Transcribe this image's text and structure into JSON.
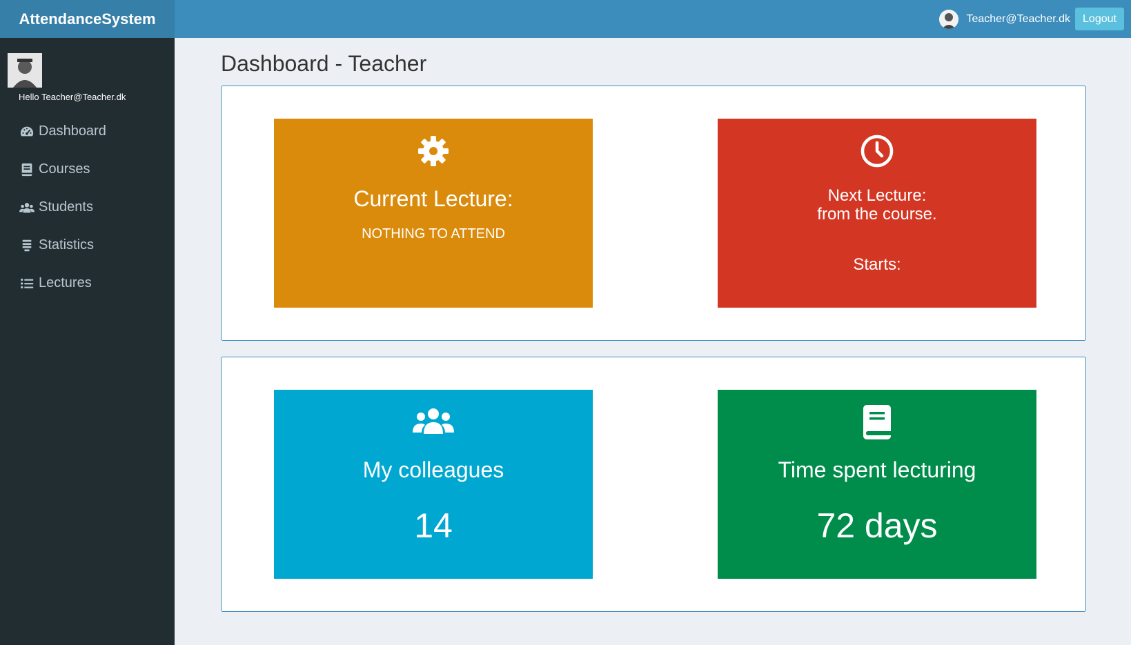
{
  "app": {
    "brand": "AttendanceSystem"
  },
  "header": {
    "user_email": "Teacher@Teacher.dk",
    "logout_label": "Logout"
  },
  "sidebar": {
    "greeting": "Hello Teacher@Teacher.dk",
    "items": [
      {
        "label": "Dashboard",
        "icon": "dashboard-icon"
      },
      {
        "label": "Courses",
        "icon": "book-icon"
      },
      {
        "label": "Students",
        "icon": "users-icon"
      },
      {
        "label": "Statistics",
        "icon": "list-stack-icon"
      },
      {
        "label": "Lectures",
        "icon": "list-icon"
      }
    ]
  },
  "page": {
    "title": "Dashboard - Teacher"
  },
  "tiles": {
    "current_lecture": {
      "title": "Current Lecture:",
      "status": "NOTHING TO ATTEND",
      "icon": "gear-icon",
      "color": "#db8b0b"
    },
    "next_lecture": {
      "line1": "Next Lecture:",
      "line2": "from the course.",
      "starts": "Starts:",
      "icon": "clock-icon",
      "color": "#d33724"
    },
    "colleagues": {
      "label": "My colleagues",
      "value": "14",
      "icon": "users-icon",
      "color": "#00a7d0"
    },
    "time_spent": {
      "label": "Time spent lecturing",
      "value": "72 days",
      "icon": "book-icon",
      "color": "#008d4c"
    }
  },
  "colors": {
    "header": "#3c8dbc",
    "brand_bg": "#367fa9",
    "sidebar": "#222d32",
    "logout": "#5bc0de",
    "page_bg": "#ecf0f5"
  }
}
